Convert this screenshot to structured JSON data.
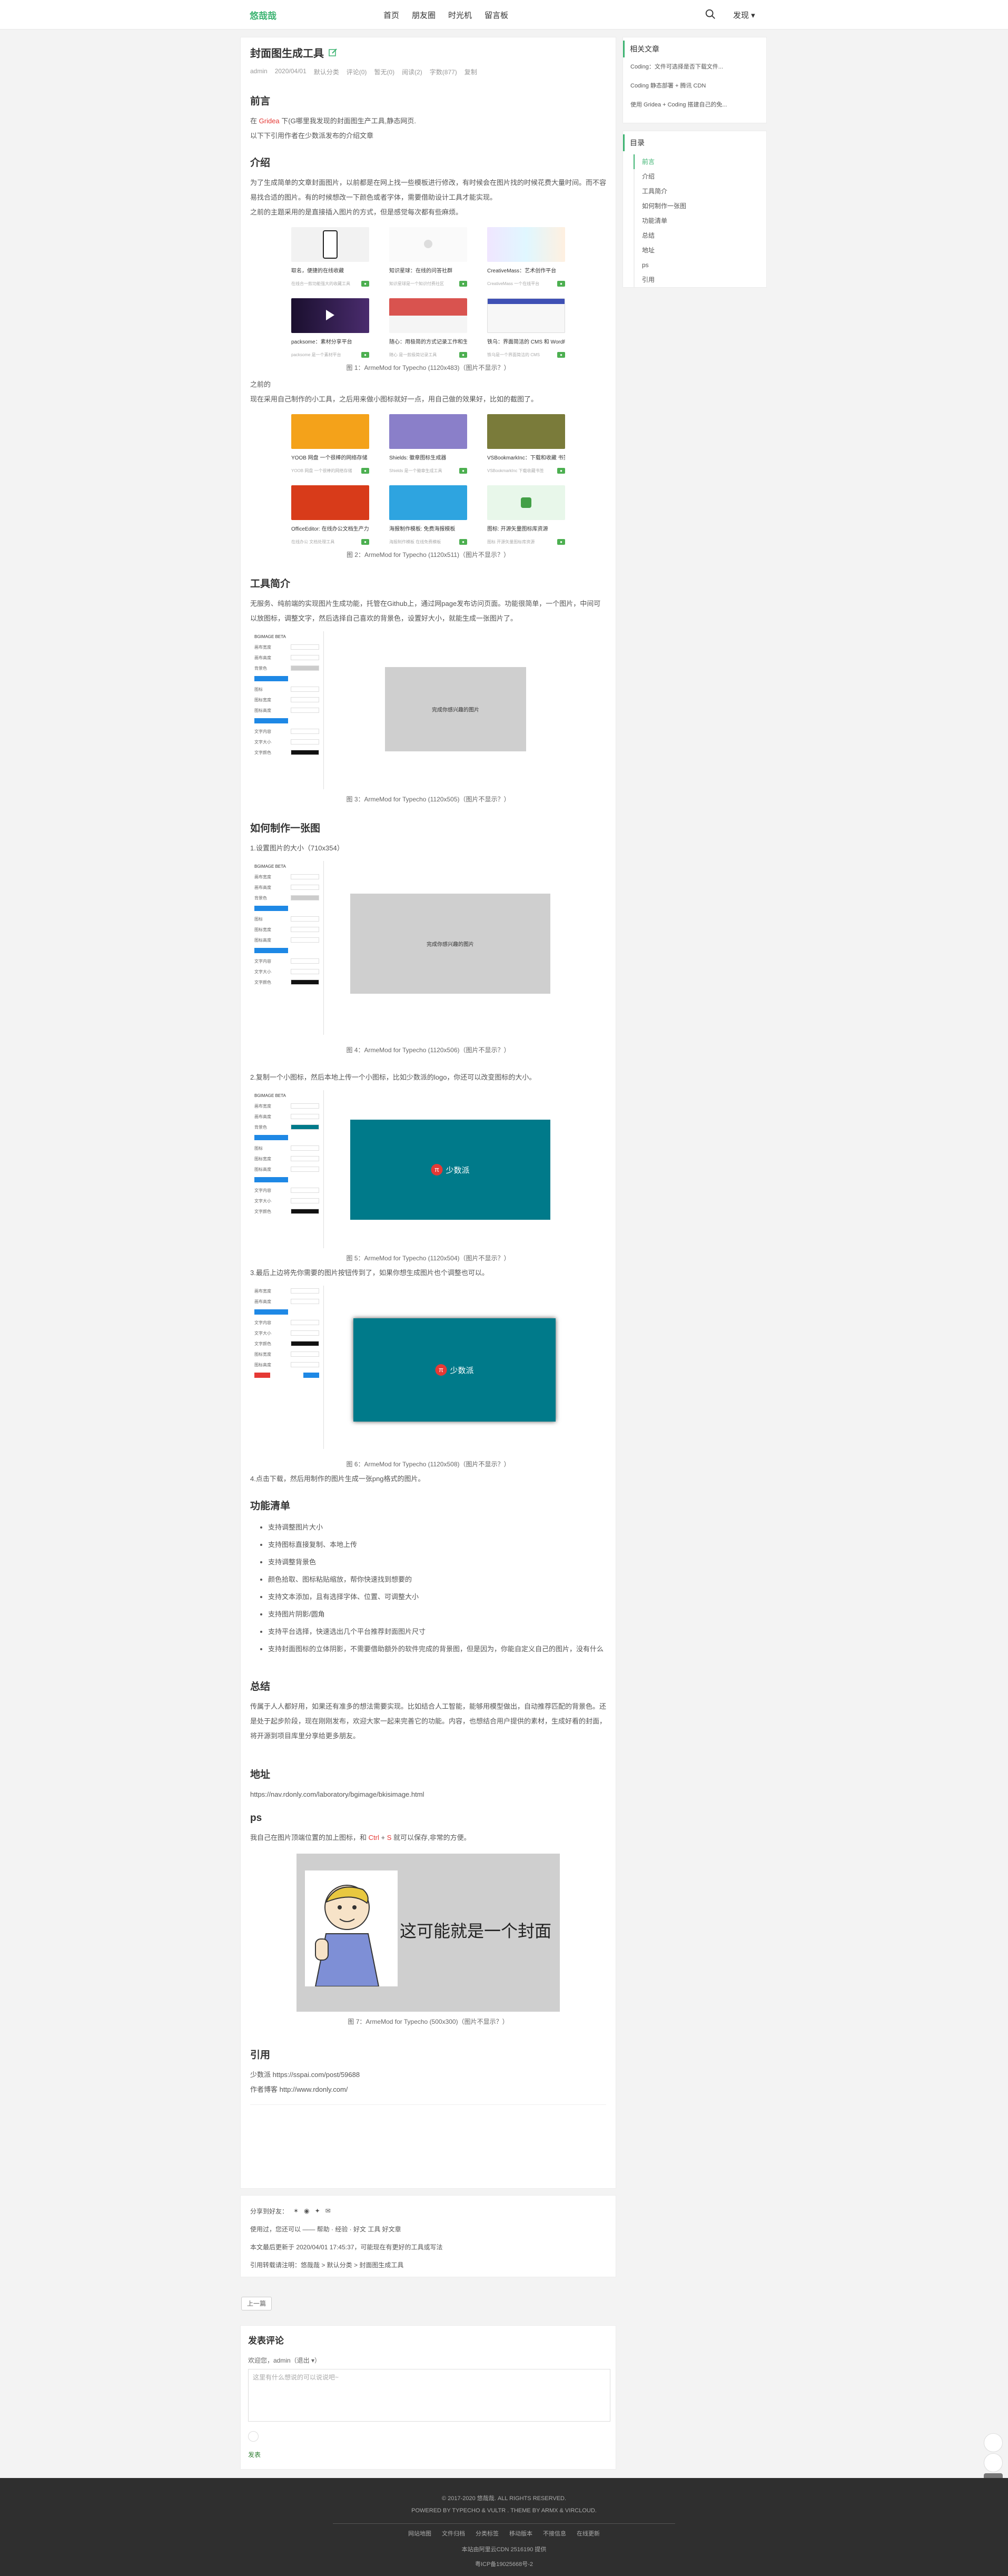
{
  "header": {
    "logo": "悠哉哉",
    "nav": [
      "首页",
      "朋友圈",
      "时光机",
      "留言板"
    ],
    "discover": "发现 ▾"
  },
  "article": {
    "title": "封面图生成工具",
    "meta": [
      "admin",
      "2020/04/01",
      "默认分类",
      "评论(0)",
      "暂无(0)",
      "阅读(2)",
      "字数(877)",
      "复制"
    ],
    "sec_preface": "前言",
    "preface_p1_a": "在",
    "preface_p1_b": "Gridea",
    "preface_p1_c": "下(G哪里我发现的封面图生产工具,静态网页.",
    "preface_p2": "以下下引用作者在少数派发布的介绍文章",
    "sec_intro": "介绍",
    "intro_p1": "为了生成简单的文章封面图片，以前都是在网上找一些模板进行修改，有时候会在图片找的时候花费大量时间。而不容易找合适的图片。有的时候想改一下颜色或者字体，需要借助设计工具才能实现。",
    "intro_p2": "之前的主题采用的是直接插入图片的方式，但是感觉每次都有些麻烦。",
    "gallery1": [
      {
        "title": "取名，便捷的在线收藏",
        "sub": "在线合一款功能强大的收藏工具"
      },
      {
        "title": "知识星球：在线的问答社群",
        "sub": "知识星球是一个知识付费社区"
      },
      {
        "title": "CreativeMass：艺术创作平台",
        "sub": "CreativeMass 一个在线平台"
      },
      {
        "title": "packsome：素材分享平台",
        "sub": "packsome 是一个素材平台"
      },
      {
        "title": "随心：用极简的方式记录工作和生活",
        "sub": "随心 是一款极简记录工具"
      },
      {
        "title": "铁乌：界面简洁的 CMS 和 WordPress 主题",
        "sub": "铁乌是一个界面简洁的 CMS"
      }
    ],
    "caption1": "图 1：ArmeMod for Typecho (1120x483)（图片不显示？）",
    "mid_p1": "之前的",
    "mid_p2": "现在采用自己制作的小工具，之后用来做小图标就好一点，用自己做的效果好，比如的截图了。",
    "gallery2": [
      {
        "title": "YOOB 网盘 一个很棒的网络存储",
        "sub": "YOOB 网盘 一个很棒的网络存储"
      },
      {
        "title": "Shields: 徽章图标生成器",
        "sub": "Shields 是一个徽章生成工具"
      },
      {
        "title": "VSBookmarkInc：下载和收藏 书签",
        "sub": "VSBookmarkInc 下载收藏书签"
      },
      {
        "title": "OfficeEditor: 在线办公文档生产力工具",
        "sub": "在线办公 文档处理工具"
      },
      {
        "title": "海报制作模板: 免费海报模板",
        "sub": "海报制作模板 在线免费模板"
      },
      {
        "title": "图标: 开源矢量图标库资源",
        "sub": "图标 开源矢量图标库资源"
      }
    ],
    "caption2": "图 2：ArmeMod for Typecho (1120x511)（图片不显示？）",
    "sec_tool": "工具简介",
    "tool_p": "无服务、纯前端的实现图片生成功能，托管在Github上，通过网page发布访问页面。功能很简单，一个图片，中间可以放图标，调整文字，然后选择自己喜欢的背景色，设置好大小，就能生成一张图片了。",
    "panel_title": "BGIMAGE BETA",
    "panel_rows": [
      "画布宽度",
      "画布高度",
      "背景色",
      "",
      "图标",
      "图标宽度",
      "图标高度",
      "",
      "文字内容",
      "文字大小",
      "文字颜色"
    ],
    "preview_text": "完成你感兴趣的图片",
    "caption3": "图 3：ArmeMod for Typecho (1120x505)（图片不显示？）",
    "sec_howto": "如何制作一张图",
    "step1": "1.设置图片的大小（710x354）",
    "caption4": "图 4：ArmeMod for Typecho (1120x506)（图片不显示？）",
    "step2": "2.复制一个小图标，然后本地上传一个小图标，比如少数派的logo，你还可以改变图标的大小。",
    "logo_text": "少数派",
    "caption5": "图 5：ArmeMod for Typecho (1120x504)（图片不显示？）",
    "step3": "3.最后上边将先你需要的图片按钮传到了，如果你想生成图片也个调整也可以。",
    "caption6": "图 6：ArmeMod for Typecho (1120x508)（图片不显示？）",
    "step4": "4.点击下载，然后用制作的图片生成一张png格式的图片。",
    "sec_features": "功能清单",
    "features": [
      "支持调整图片大小",
      "支持图标直接复制、本地上传",
      "支持调整背景色",
      "颜色拾取、图标粘贴缩放，帮你快速找到想要的",
      "支持文本添加，且有选择字体、位置、可调整大小",
      "支持图片阴影/圆角",
      "支持平台选择，快速选出几个平台推荐封面图片尺寸",
      "支持封面图标的立体阴影，不需要借助额外的软件完成的背景图，但是因为，你能自定义自己的图片，没有什么"
    ],
    "sec_summary": "总结",
    "summary_p": "传属于人人都好用，如果还有准多的想法需要实现。比如结合人工智能，能够用模型做出，自动推荐匹配的背景色。还是处于起步阶段，现在刚刚发布，欢迎大家一起来完善它的功能。内容，也想结合用户提供的素材，生成好看的封面，将开源到项目库里分享给更多朋友。",
    "sec_address": "地址",
    "address": "https://nav.rdonly.com/laboratory/bgimage/bkisimage.html",
    "sec_ps": "ps",
    "ps_a": "我自己在图片顶端位置的加上图标，和",
    "ps_key1": "Ctrl",
    "ps_plus": " + ",
    "ps_key2": "S",
    "ps_b": " 就可以保存,非常的方便。",
    "cover_text": "这可能就是一个封面",
    "caption7": "图 7：ArmeMod for Typecho (500x300)（图片不显示？）",
    "sec_ref": "引用",
    "ref1": "少数派 https://sspai.com/post/59688",
    "ref2": "作者博客 http://www.rdonly.com/"
  },
  "share": {
    "row1": "分享到好友：",
    "row2": "使用过，您还可以 —— 帮助 · 经验 · 好文 工具 好文章",
    "row3": "本文最后更新于 2020/04/01 17:45:37，可能现在有更好的工具或写法",
    "row4": "引用转载请注明：悠哉哉 > 默认分类 > 封面图生成工具"
  },
  "pager": "上一篇",
  "comments": {
    "title": "发表评论",
    "user": "欢迎您，admin（退出 ▾）",
    "placeholder": "这里有什么想说的可以说说吧~",
    "submit": "发表"
  },
  "sidebar": {
    "related_title": "相关文章",
    "related": [
      "Coding：文件可选择是否下载文件...",
      "Coding 静态部署 + 腾讯 CDN",
      "使用 Gridea + Coding 搭建自己的免..."
    ],
    "toc_title": "目录",
    "toc": [
      "前言",
      "介绍",
      "工具简介",
      "如何制作一张图",
      "功能清单",
      "总结",
      "地址",
      "ps",
      "引用"
    ]
  },
  "footer": {
    "l1": "© 2017-2020 悠哉哉. ALL RIGHTS RESERVED.",
    "l2": "POWERED BY TYPECHO & VULTR . THEME BY ARMX & VIRCLOUD.",
    "links": [
      "网站地图",
      "文件归档",
      "分类标签",
      "移动版本",
      "不接信息",
      "在线更新"
    ],
    "l4": "本站由阿里云CDN 2516190 提供",
    "l5": "粤ICP备19025668号-2"
  }
}
